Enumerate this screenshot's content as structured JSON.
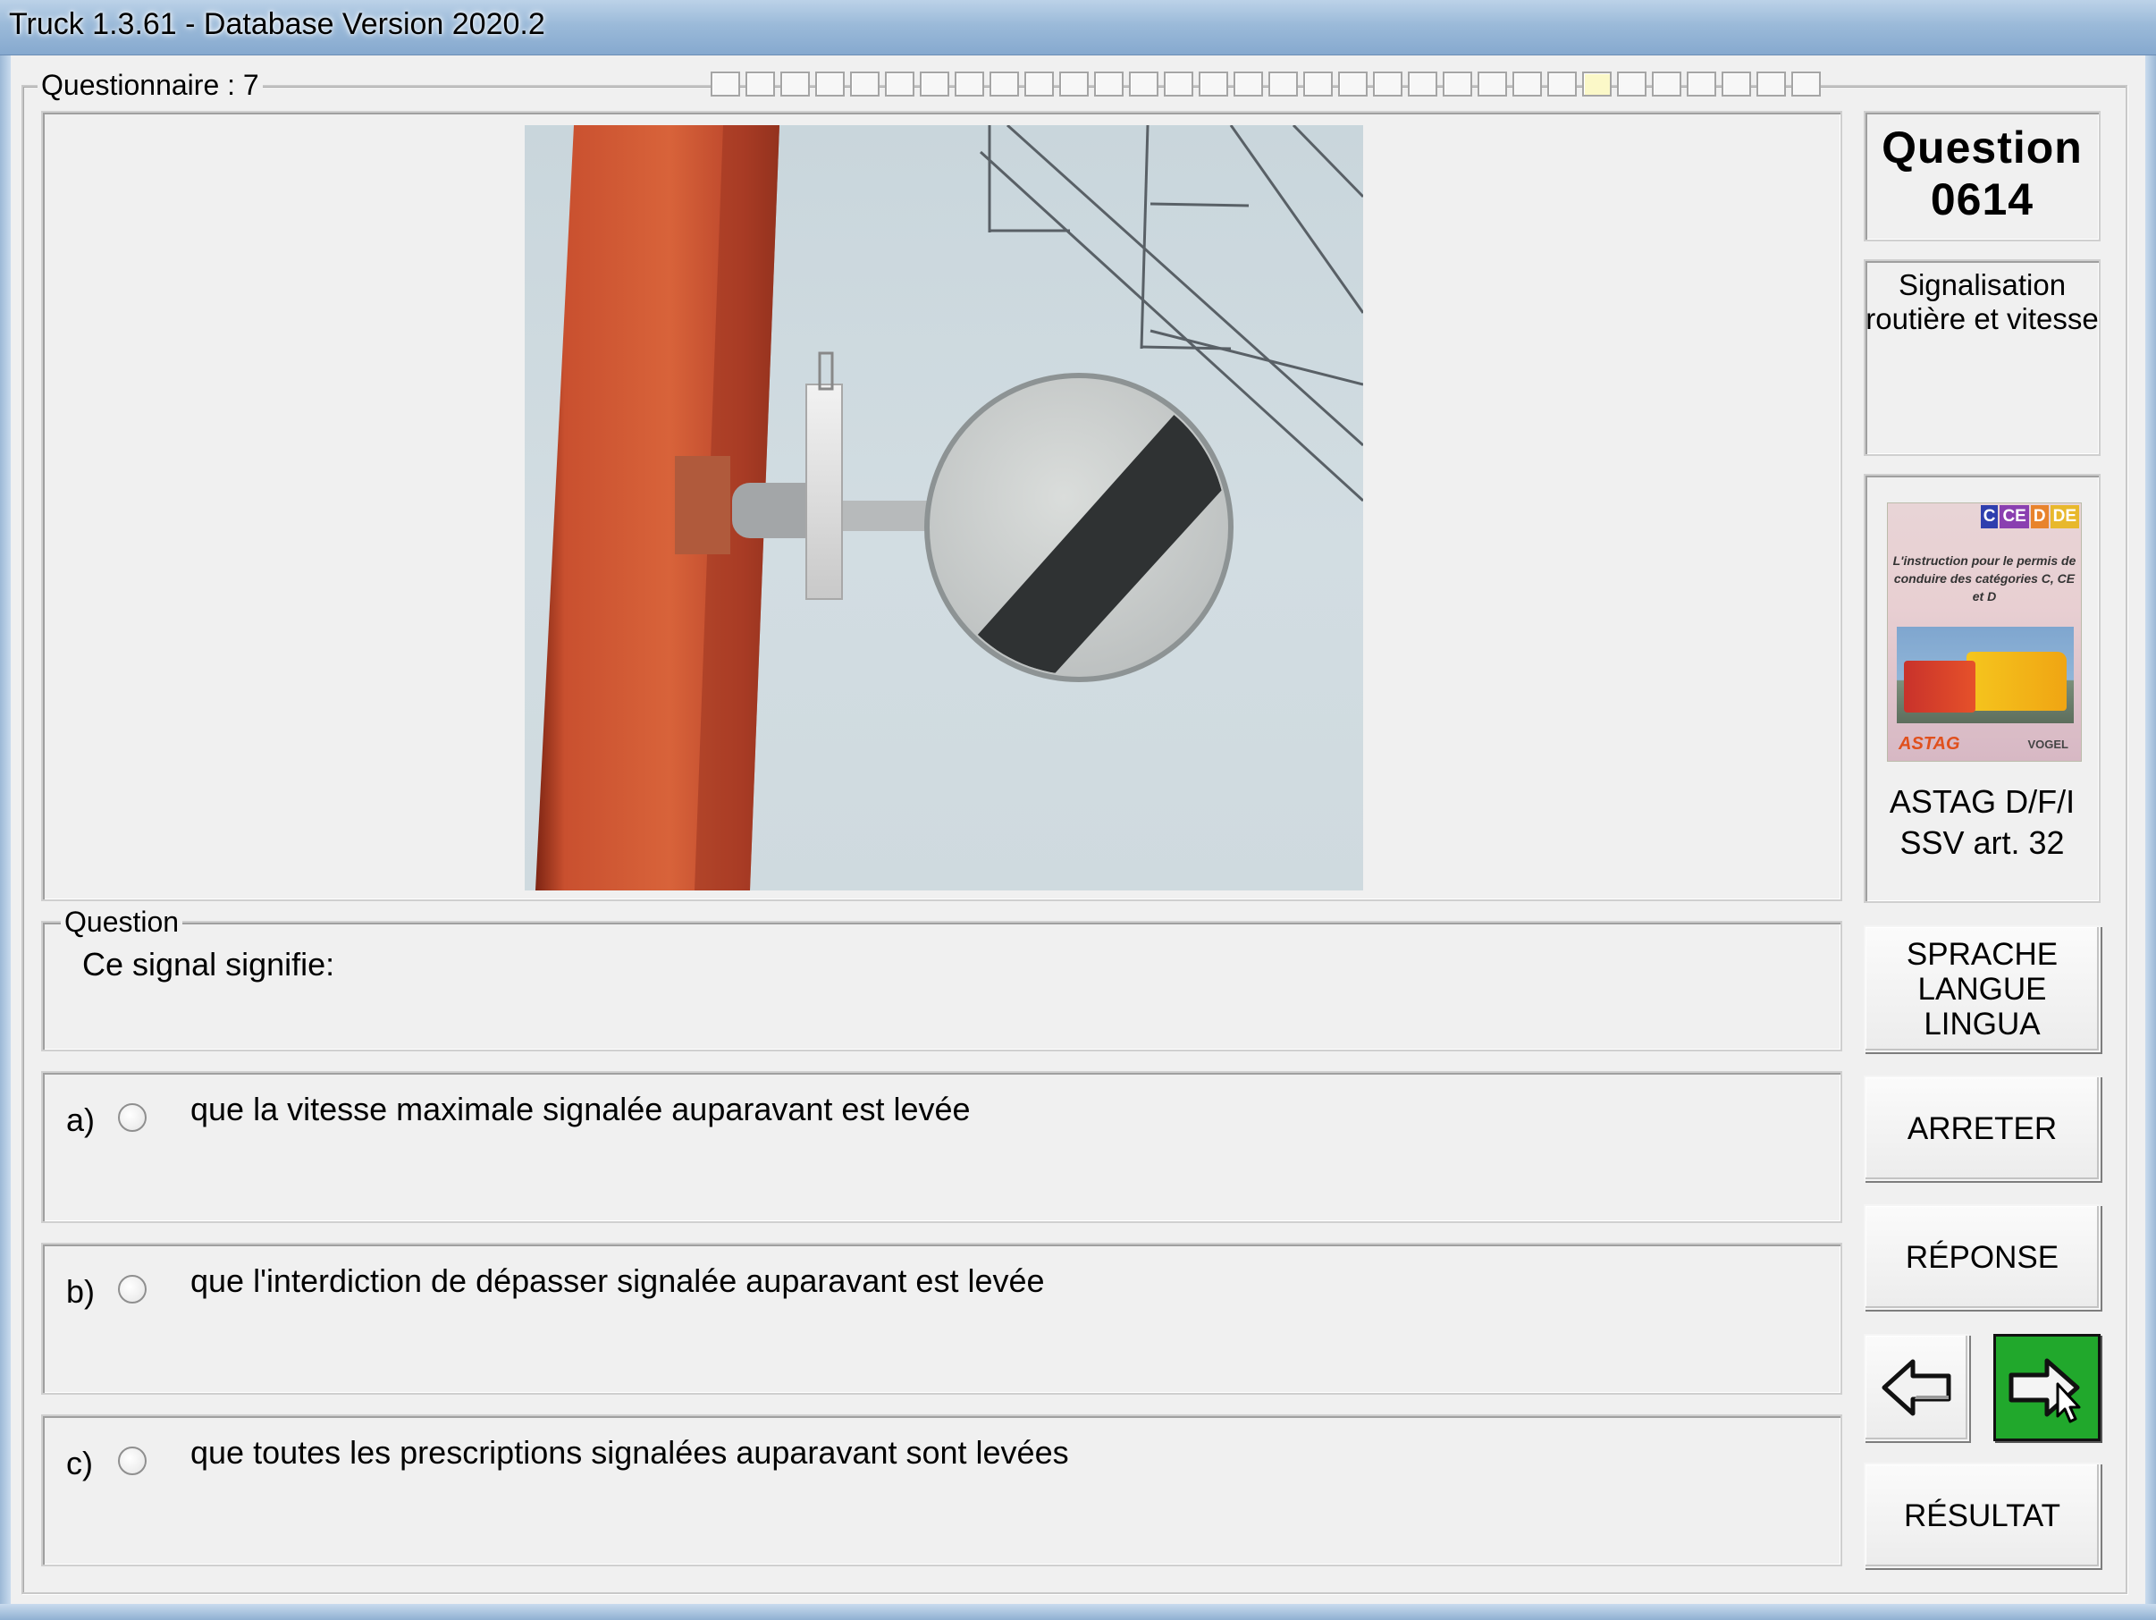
{
  "window": {
    "title": "Truck 1.3.61 - Database Version 2020.2"
  },
  "questionnaire": {
    "label": "Questionnaire : 7",
    "progress_total": 32,
    "progress_current": 26
  },
  "question_panel": {
    "caption": "Question",
    "text": "Ce signal signifie:",
    "image_icon": "end-of-all-restrictions-sign"
  },
  "answers": [
    {
      "letter": "a)",
      "text": "que la vitesse maximale signalée auparavant est levée",
      "selected": false
    },
    {
      "letter": "b)",
      "text": "que l'interdiction de dépasser signalée auparavant est levée",
      "selected": false
    },
    {
      "letter": "c)",
      "text": "que toutes les prescriptions signalées auparavant sont levées",
      "selected": false
    }
  ],
  "sidebar": {
    "question_label": "Question",
    "question_number": "0614",
    "category_line1": "Signalisation",
    "category_line2": "routière et vitesse",
    "book": {
      "tabs": [
        "C",
        "CE",
        "D",
        "DE"
      ],
      "tab_colors": [
        "#2f3fae",
        "#8a3fb0",
        "#e8832c",
        "#e8b82c"
      ],
      "cover_text": "L'instruction pour le permis de conduire des catégories C, CE et D",
      "logo_left": "ASTAG",
      "logo_right": "VOGEL"
    },
    "source_line1": "ASTAG D/F/I",
    "source_line2": "SSV art. 32"
  },
  "buttons": {
    "language_line1": "SPRACHE",
    "language_line2": "LANGUE",
    "language_line3": "LINGUA",
    "stop": "ARRETER",
    "answer": "RÉPONSE",
    "prev_icon": "arrow-left-icon",
    "next_icon": "arrow-right-icon",
    "result": "RÉSULTAT"
  },
  "colors": {
    "next_button": "#21a82c",
    "pole": "#c9502f",
    "current_progress": "#fbf8c8"
  }
}
